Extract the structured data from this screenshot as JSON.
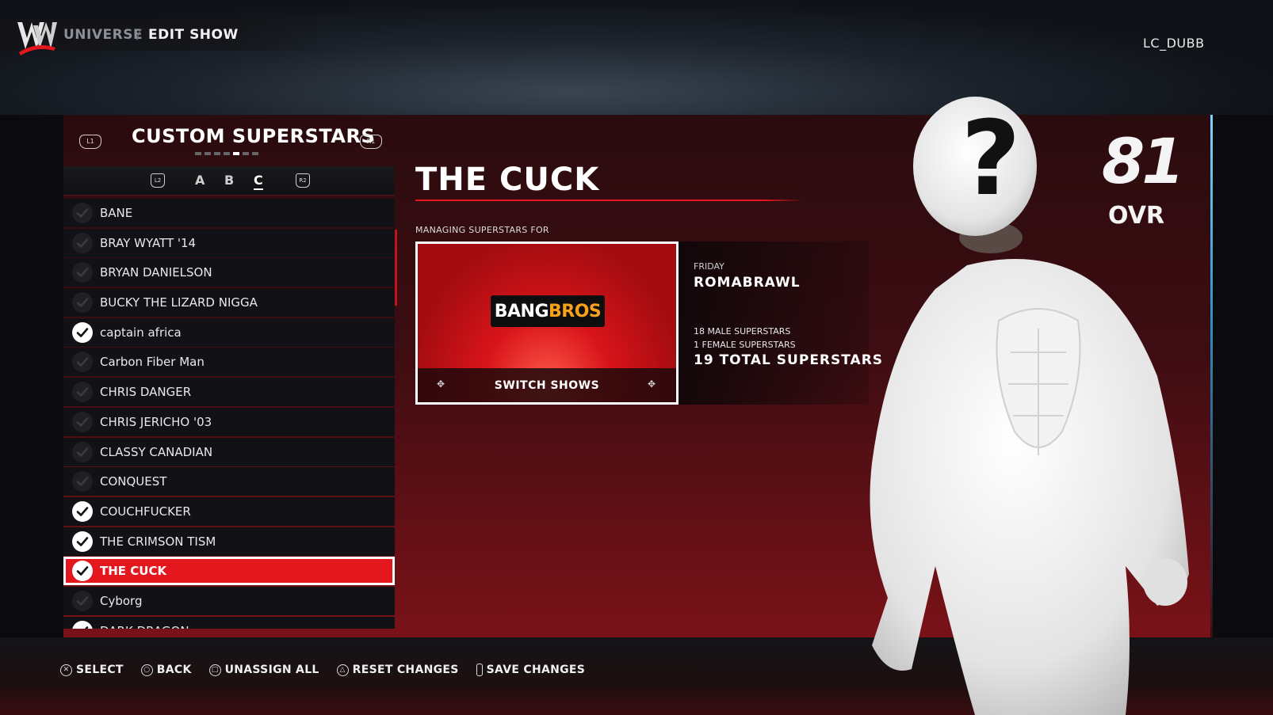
{
  "header": {
    "crumb_universe": "UNIVERSE",
    "crumb_separator": "/",
    "crumb_edit_show": "EDIT SHOW",
    "username": "LC_DUBB"
  },
  "list_panel": {
    "title": "CUSTOM SUPERSTARS",
    "left_bumper": "L1",
    "right_bumper": "R1",
    "left_trigger": "L2",
    "right_trigger": "R2",
    "letters": [
      "A",
      "B",
      "C"
    ],
    "selected_letter": "C",
    "page_count": 7,
    "current_page": 5,
    "items": [
      {
        "label": "BANE",
        "checked": false
      },
      {
        "label": "BRAY WYATT '14",
        "checked": false
      },
      {
        "label": "BRYAN DANIELSON",
        "checked": false
      },
      {
        "label": "BUCKY THE LIZARD NIGGA",
        "checked": false
      },
      {
        "label": "captain africa",
        "checked": true
      },
      {
        "label": "Carbon Fiber Man",
        "checked": false
      },
      {
        "label": "CHRIS DANGER",
        "checked": false
      },
      {
        "label": "CHRIS JERICHO '03",
        "checked": false
      },
      {
        "label": "CLASSY CANADIAN",
        "checked": false
      },
      {
        "label": "CONQUEST",
        "checked": false
      },
      {
        "label": "COUCHFUCKER",
        "checked": true
      },
      {
        "label": "THE CRIMSON TISM",
        "checked": true
      },
      {
        "label": "THE CUCK",
        "checked": true,
        "selected": true
      },
      {
        "label": "Cyborg",
        "checked": false
      },
      {
        "label": "DARK DRAGON",
        "checked": true
      }
    ]
  },
  "detail": {
    "name": "THE CUCK",
    "managing_label": "MANAGING SUPERSTARS FOR",
    "show_logo_part1": "BANG",
    "show_logo_part2": "BROS",
    "switch_shows": "SWITCH SHOWS",
    "day": "FRIDAY",
    "show_name": "ROMABRAWL",
    "male_count": "18 MALE SUPERSTARS",
    "female_count": "1 FEMALE SUPERSTARS",
    "total_count": "19 TOTAL SUPERSTARS"
  },
  "rating": {
    "value": "81",
    "label": "OVR"
  },
  "footer": {
    "select": "SELECT",
    "back": "BACK",
    "unassign_all": "UNASSIGN ALL",
    "reset_changes": "RESET CHANGES",
    "save_changes": "SAVE CHANGES"
  },
  "colors": {
    "accent_red": "#e3171d",
    "panel_dark": "#121216"
  }
}
